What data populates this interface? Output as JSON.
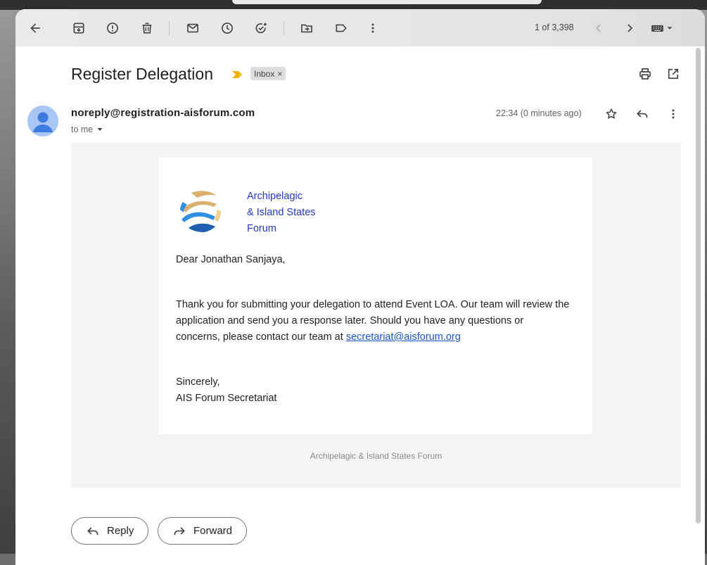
{
  "toolbar": {
    "pager_text": "1 of 3,398"
  },
  "email": {
    "subject": "Register Delegation",
    "label": "Inbox",
    "label_remove": "×",
    "sender": "noreply@registration-aisforum.com",
    "recipient": "to me",
    "timestamp": "22:34 (0 minutes ago)"
  },
  "body": {
    "org_line1": "Archipelagic",
    "org_line2": "& Island States",
    "org_line3": "Forum",
    "greeting": "Dear Jonathan Sanjaya,",
    "paragraph": "Thank you for submitting your delegation to attend Event LOA. Our team will review the application and send you a response later. Should you have any questions or concerns, please contact our team at ",
    "contact_email": "secretariat@aisforum.org",
    "signoff_line1": "Sincerely,",
    "signoff_line2": "AIS Forum Secretariat",
    "footer": "Archipelagic & Island States Forum"
  },
  "actions": {
    "reply_label": "Reply",
    "forward_label": "Forward"
  },
  "colors": {
    "link": "#1a55c8",
    "org_name": "#2438c9",
    "importance": "#f4b400"
  }
}
